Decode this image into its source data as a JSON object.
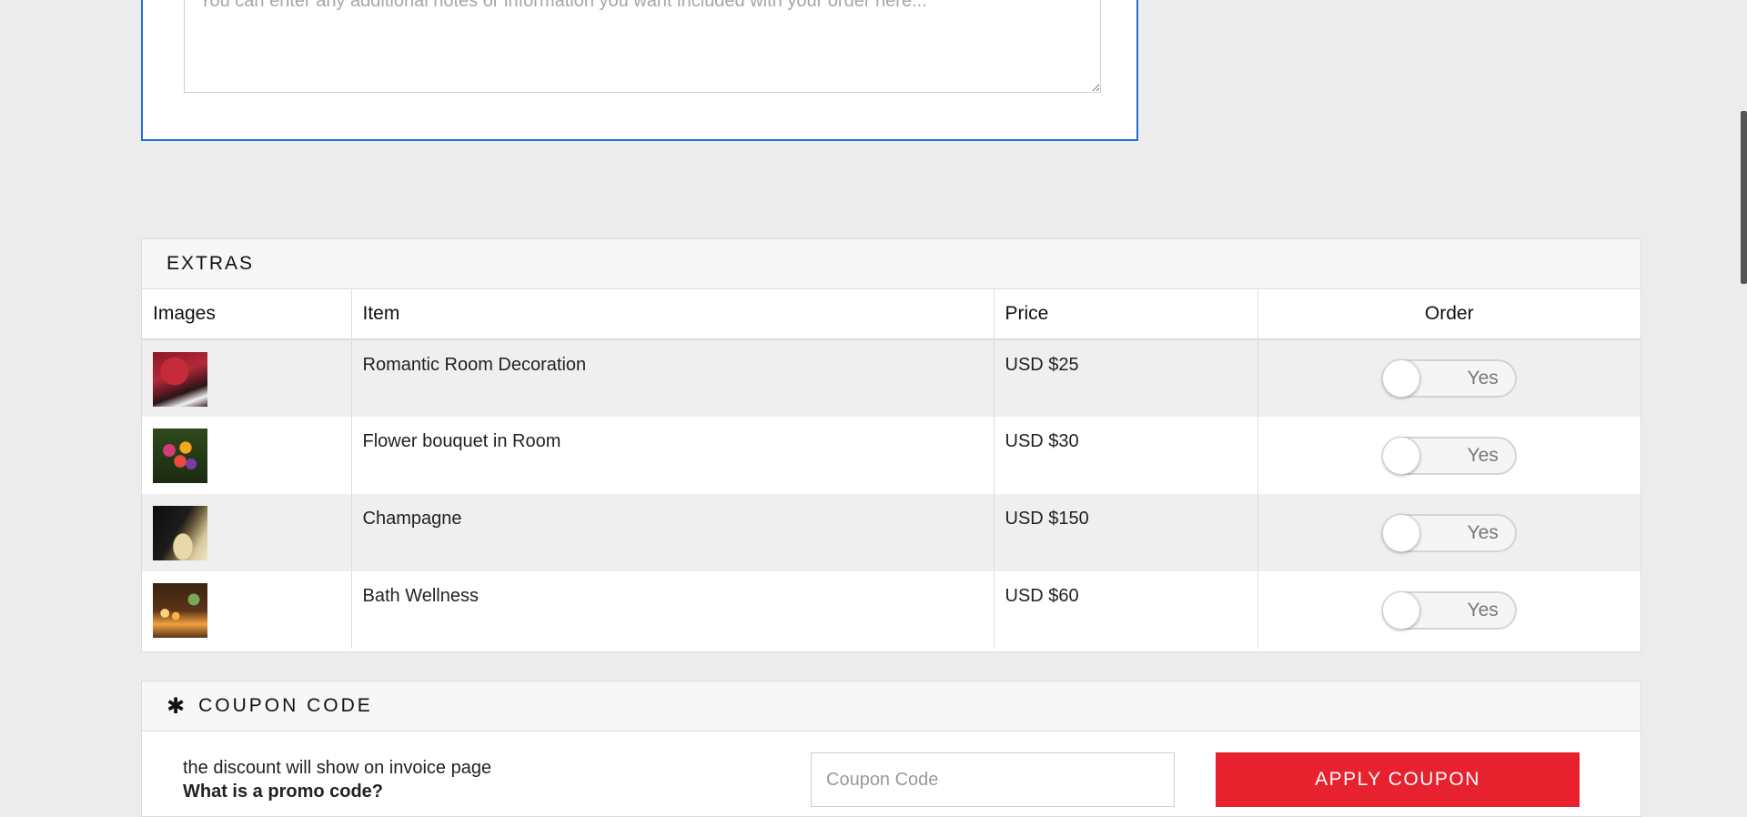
{
  "notes": {
    "placeholder": "You can enter any additional notes or information you want included with your order here..."
  },
  "extras": {
    "heading": "EXTRAS",
    "columns": {
      "images": "Images",
      "item": "Item",
      "price": "Price",
      "order": "Order"
    },
    "rows": [
      {
        "image": "romantic-room-image",
        "item": "Romantic Room Decoration",
        "price": "USD $25",
        "toggle_label": "Yes",
        "checked": false
      },
      {
        "image": "flower-bouquet-image",
        "item": "Flower bouquet in Room",
        "price": "USD $30",
        "toggle_label": "Yes",
        "checked": false
      },
      {
        "image": "champagne-image",
        "item": "Champagne",
        "price": "USD $150",
        "toggle_label": "Yes",
        "checked": false
      },
      {
        "image": "bath-wellness-image",
        "item": "Bath Wellness",
        "price": "USD $60",
        "toggle_label": "Yes",
        "checked": false
      }
    ]
  },
  "coupon": {
    "icon": "asterisk-icon",
    "heading": "COUPON CODE",
    "note": "the discount will show on invoice page",
    "question": "What is a promo code?",
    "input_placeholder": "Coupon Code",
    "button_label": "APPLY COUPON"
  },
  "colors": {
    "accent_blue": "#1f6fd1",
    "apply_red": "#e8212f",
    "page_bg": "#ececec"
  }
}
